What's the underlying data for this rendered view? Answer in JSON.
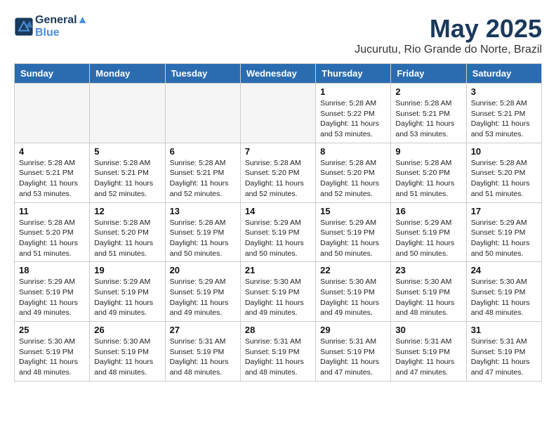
{
  "header": {
    "logo_line1": "General",
    "logo_line2": "Blue",
    "month_title": "May 2025",
    "location": "Jucurutu, Rio Grande do Norte, Brazil"
  },
  "days_of_week": [
    "Sunday",
    "Monday",
    "Tuesday",
    "Wednesday",
    "Thursday",
    "Friday",
    "Saturday"
  ],
  "weeks": [
    [
      {
        "day": "",
        "detail": ""
      },
      {
        "day": "",
        "detail": ""
      },
      {
        "day": "",
        "detail": ""
      },
      {
        "day": "",
        "detail": ""
      },
      {
        "day": "1",
        "detail": "Sunrise: 5:28 AM\nSunset: 5:22 PM\nDaylight: 11 hours\nand 53 minutes."
      },
      {
        "day": "2",
        "detail": "Sunrise: 5:28 AM\nSunset: 5:21 PM\nDaylight: 11 hours\nand 53 minutes."
      },
      {
        "day": "3",
        "detail": "Sunrise: 5:28 AM\nSunset: 5:21 PM\nDaylight: 11 hours\nand 53 minutes."
      }
    ],
    [
      {
        "day": "4",
        "detail": "Sunrise: 5:28 AM\nSunset: 5:21 PM\nDaylight: 11 hours\nand 53 minutes."
      },
      {
        "day": "5",
        "detail": "Sunrise: 5:28 AM\nSunset: 5:21 PM\nDaylight: 11 hours\nand 52 minutes."
      },
      {
        "day": "6",
        "detail": "Sunrise: 5:28 AM\nSunset: 5:21 PM\nDaylight: 11 hours\nand 52 minutes."
      },
      {
        "day": "7",
        "detail": "Sunrise: 5:28 AM\nSunset: 5:20 PM\nDaylight: 11 hours\nand 52 minutes."
      },
      {
        "day": "8",
        "detail": "Sunrise: 5:28 AM\nSunset: 5:20 PM\nDaylight: 11 hours\nand 52 minutes."
      },
      {
        "day": "9",
        "detail": "Sunrise: 5:28 AM\nSunset: 5:20 PM\nDaylight: 11 hours\nand 51 minutes."
      },
      {
        "day": "10",
        "detail": "Sunrise: 5:28 AM\nSunset: 5:20 PM\nDaylight: 11 hours\nand 51 minutes."
      }
    ],
    [
      {
        "day": "11",
        "detail": "Sunrise: 5:28 AM\nSunset: 5:20 PM\nDaylight: 11 hours\nand 51 minutes."
      },
      {
        "day": "12",
        "detail": "Sunrise: 5:28 AM\nSunset: 5:20 PM\nDaylight: 11 hours\nand 51 minutes."
      },
      {
        "day": "13",
        "detail": "Sunrise: 5:28 AM\nSunset: 5:19 PM\nDaylight: 11 hours\nand 50 minutes."
      },
      {
        "day": "14",
        "detail": "Sunrise: 5:29 AM\nSunset: 5:19 PM\nDaylight: 11 hours\nand 50 minutes."
      },
      {
        "day": "15",
        "detail": "Sunrise: 5:29 AM\nSunset: 5:19 PM\nDaylight: 11 hours\nand 50 minutes."
      },
      {
        "day": "16",
        "detail": "Sunrise: 5:29 AM\nSunset: 5:19 PM\nDaylight: 11 hours\nand 50 minutes."
      },
      {
        "day": "17",
        "detail": "Sunrise: 5:29 AM\nSunset: 5:19 PM\nDaylight: 11 hours\nand 50 minutes."
      }
    ],
    [
      {
        "day": "18",
        "detail": "Sunrise: 5:29 AM\nSunset: 5:19 PM\nDaylight: 11 hours\nand 49 minutes."
      },
      {
        "day": "19",
        "detail": "Sunrise: 5:29 AM\nSunset: 5:19 PM\nDaylight: 11 hours\nand 49 minutes."
      },
      {
        "day": "20",
        "detail": "Sunrise: 5:29 AM\nSunset: 5:19 PM\nDaylight: 11 hours\nand 49 minutes."
      },
      {
        "day": "21",
        "detail": "Sunrise: 5:30 AM\nSunset: 5:19 PM\nDaylight: 11 hours\nand 49 minutes."
      },
      {
        "day": "22",
        "detail": "Sunrise: 5:30 AM\nSunset: 5:19 PM\nDaylight: 11 hours\nand 49 minutes."
      },
      {
        "day": "23",
        "detail": "Sunrise: 5:30 AM\nSunset: 5:19 PM\nDaylight: 11 hours\nand 48 minutes."
      },
      {
        "day": "24",
        "detail": "Sunrise: 5:30 AM\nSunset: 5:19 PM\nDaylight: 11 hours\nand 48 minutes."
      }
    ],
    [
      {
        "day": "25",
        "detail": "Sunrise: 5:30 AM\nSunset: 5:19 PM\nDaylight: 11 hours\nand 48 minutes."
      },
      {
        "day": "26",
        "detail": "Sunrise: 5:30 AM\nSunset: 5:19 PM\nDaylight: 11 hours\nand 48 minutes."
      },
      {
        "day": "27",
        "detail": "Sunrise: 5:31 AM\nSunset: 5:19 PM\nDaylight: 11 hours\nand 48 minutes."
      },
      {
        "day": "28",
        "detail": "Sunrise: 5:31 AM\nSunset: 5:19 PM\nDaylight: 11 hours\nand 48 minutes."
      },
      {
        "day": "29",
        "detail": "Sunrise: 5:31 AM\nSunset: 5:19 PM\nDaylight: 11 hours\nand 47 minutes."
      },
      {
        "day": "30",
        "detail": "Sunrise: 5:31 AM\nSunset: 5:19 PM\nDaylight: 11 hours\nand 47 minutes."
      },
      {
        "day": "31",
        "detail": "Sunrise: 5:31 AM\nSunset: 5:19 PM\nDaylight: 11 hours\nand 47 minutes."
      }
    ]
  ]
}
